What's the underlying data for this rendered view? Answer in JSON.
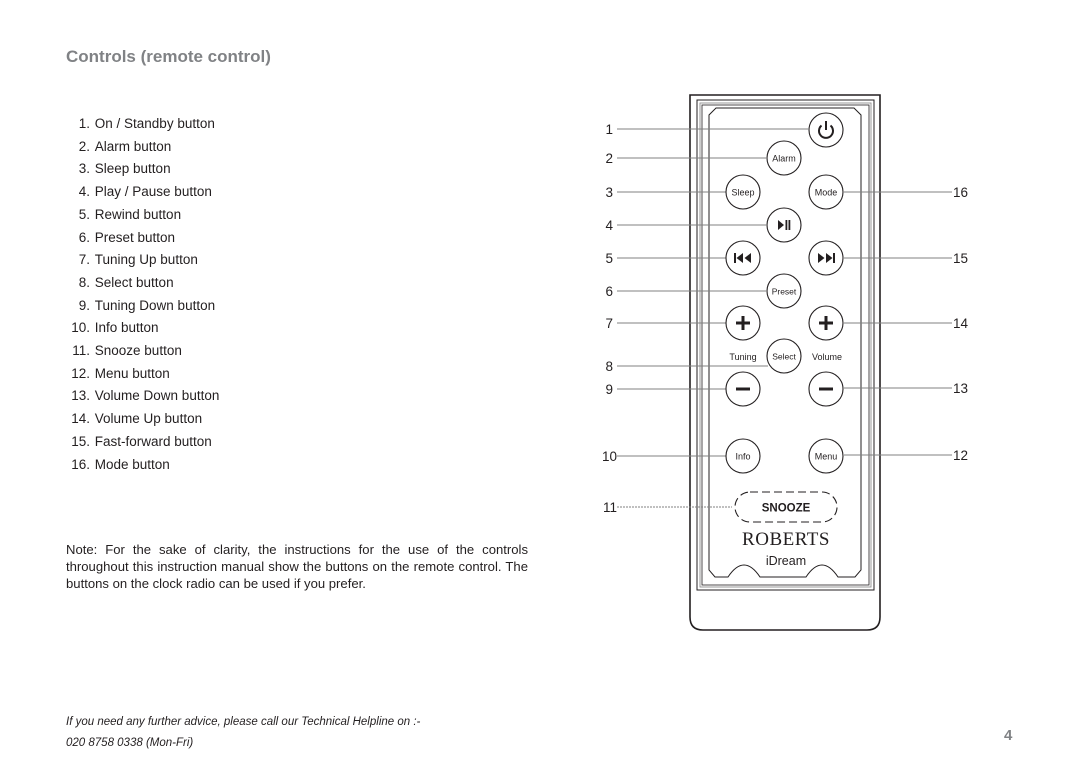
{
  "page": {
    "title": "Controls (remote control)",
    "page_number": "4"
  },
  "controls_list": [
    {
      "num": "1.",
      "label": "On / Standby button"
    },
    {
      "num": "2.",
      "label": "Alarm button"
    },
    {
      "num": "3.",
      "label": "Sleep button"
    },
    {
      "num": "4.",
      "label": "Play / Pause button"
    },
    {
      "num": "5.",
      "label": "Rewind button"
    },
    {
      "num": "6.",
      "label": "Preset button"
    },
    {
      "num": "7.",
      "label": "Tuning Up button"
    },
    {
      "num": "8.",
      "label": "Select button"
    },
    {
      "num": "9.",
      "label": "Tuning Down button"
    },
    {
      "num": "10.",
      "label": "Info button"
    },
    {
      "num": "11.",
      "label": "Snooze button"
    },
    {
      "num": "12.",
      "label": "Menu button"
    },
    {
      "num": "13.",
      "label": "Volume Down button"
    },
    {
      "num": "14.",
      "label": "Volume Up button"
    },
    {
      "num": "15.",
      "label": "Fast-forward button"
    },
    {
      "num": "16.",
      "label": "Mode button"
    }
  ],
  "note": "Note: For the sake of clarity, the instructions for the use of the controls throughout this instruction manual show the buttons on the remote control. The buttons on the clock radio can be used if you prefer.",
  "footer": {
    "helpline_text": "If you need any further advice, please call our Technical Helpline on :-",
    "helpline_phone": "020 8758 0338 (Mon-Fri)"
  },
  "remote": {
    "brand": "ROBERTS",
    "model": "iDream",
    "buttons": {
      "power": {
        "icon": "power-icon"
      },
      "alarm": {
        "label": "Alarm"
      },
      "sleep": {
        "label": "Sleep"
      },
      "mode": {
        "label": "Mode"
      },
      "play_pause": {
        "icon": "play-pause-icon"
      },
      "rewind": {
        "icon": "rewind-icon"
      },
      "fast_forward": {
        "icon": "fast-forward-icon"
      },
      "preset": {
        "label": "Preset"
      },
      "tuning_up": {
        "icon": "plus-icon"
      },
      "volume_up": {
        "icon": "plus-icon"
      },
      "select": {
        "label": "Select"
      },
      "tuning_down": {
        "icon": "minus-icon"
      },
      "volume_down": {
        "icon": "minus-icon"
      },
      "info": {
        "label": "Info"
      },
      "menu": {
        "label": "Menu"
      },
      "snooze": {
        "label": "SNOOZE"
      }
    },
    "group_labels": {
      "tuning": "Tuning",
      "volume": "Volume"
    },
    "callouts_left": [
      "1",
      "2",
      "3",
      "4",
      "5",
      "6",
      "7",
      "8",
      "9",
      "10",
      "11"
    ],
    "callouts_right": [
      "16",
      "15",
      "14",
      "13",
      "12"
    ]
  }
}
